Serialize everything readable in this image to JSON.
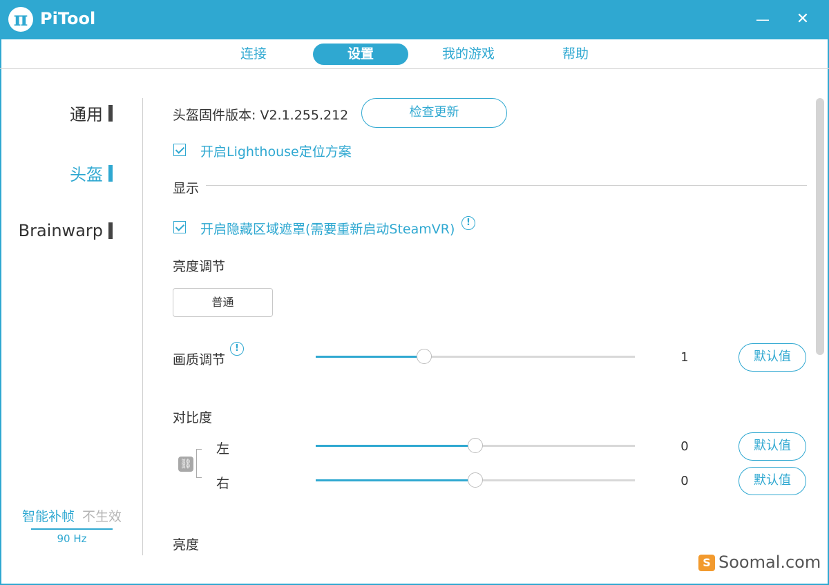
{
  "app": {
    "title": "PiTool",
    "logo_glyph": "π",
    "accent": "#2fa8d1"
  },
  "window_controls": {
    "minimize": "—",
    "close": "✕"
  },
  "tabs": [
    {
      "label": "连接",
      "active": false
    },
    {
      "label": "设置",
      "active": true
    },
    {
      "label": "我的游戏",
      "active": false
    },
    {
      "label": "帮助",
      "active": false
    }
  ],
  "sidebar": {
    "items": [
      {
        "label": "通用",
        "active": false
      },
      {
        "label": "头盔",
        "active": true
      },
      {
        "label": "Brainwarp",
        "active": false
      }
    ],
    "frame_interp": {
      "label": "智能补帧",
      "status": "不生效",
      "rate": "90 Hz"
    }
  },
  "main": {
    "firmware_label": "头盔固件版本: V2.1.255.212",
    "check_update": "检查更新",
    "lighthouse": {
      "label": "开启Lighthouse定位方案",
      "checked": true
    },
    "display_section": "显示",
    "hidden_area": {
      "label": "开启隐藏区域遮罩(需要重新启动SteamVR)",
      "checked": true
    },
    "info_glyph": "!",
    "brightness_adjust_label": "亮度调节",
    "brightness_mode": "普通",
    "quality": {
      "label": "画质调节",
      "value": "1",
      "fill": 0.34,
      "default_label": "默认值"
    },
    "contrast": {
      "label": "对比度",
      "link_glyph": "⛓",
      "left": {
        "label": "左",
        "value": "0",
        "fill": 0.5,
        "default_label": "默认值"
      },
      "right": {
        "label": "右",
        "value": "0",
        "fill": 0.5,
        "default_label": "默认值"
      }
    },
    "brightness_label": "亮度"
  },
  "watermark": {
    "icon": "S",
    "text": "Soomal.com"
  }
}
